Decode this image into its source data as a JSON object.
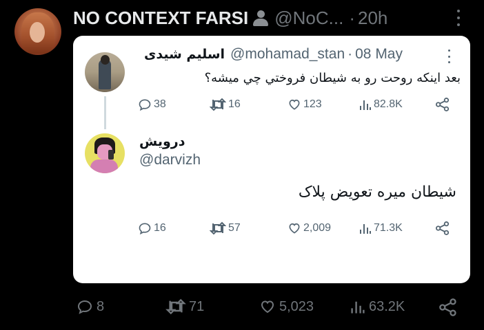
{
  "outer_tweet": {
    "name": "NO CONTEXT FARSI",
    "handle": "@NoC...",
    "separator": "·",
    "time": "20h",
    "stats": {
      "replies": "8",
      "retweets": "71",
      "likes": "5,023",
      "views": "63.2K"
    }
  },
  "quoted_thread": {
    "tweet1": {
      "name": "اسلیم شیدی",
      "handle": "@mohamad_stan",
      "separator": "·",
      "date": "08 May",
      "text": "بعد اینکه روحت رو به شیطان فروختي چي میشه؟",
      "stats": {
        "replies": "38",
        "retweets": "16",
        "likes": "123",
        "views": "82.8K"
      }
    },
    "tweet2": {
      "name": "درویش",
      "handle": "@darvizh",
      "text": "شیطان میره تعویض پلاک",
      "stats": {
        "replies": "16",
        "retweets": "57",
        "likes": "2,009",
        "views": "71.3K"
      }
    }
  },
  "icons": [
    "reply-icon",
    "retweet-icon",
    "like-icon",
    "views-icon",
    "share-icon",
    "more-icon",
    "person-icon"
  ]
}
